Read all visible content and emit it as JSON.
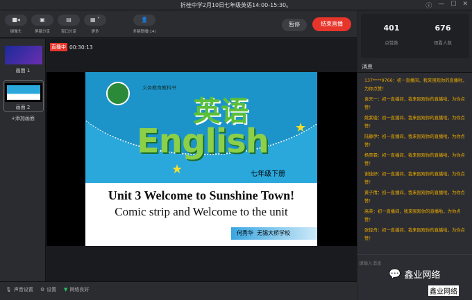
{
  "window": {
    "title": "折桂中学2月10日七年级英语14:00-15:30。"
  },
  "toolbar": {
    "items": [
      {
        "label": "摄像头",
        "icon": "camera-icon"
      },
      {
        "label": "屏幕分享",
        "icon": "screen-share-icon"
      },
      {
        "label": "窗口分享",
        "icon": "window-share-icon"
      },
      {
        "label": "更多",
        "icon": "grid-icon"
      },
      {
        "label": "多路联播(14)",
        "icon": "user-icon"
      }
    ],
    "pause": "暂停",
    "end": "结束直播"
  },
  "left": {
    "scenes": [
      "画面 1",
      "画面 2"
    ],
    "add": "+添加画面"
  },
  "main": {
    "live_badge": "直播中",
    "timer": "00:30:13"
  },
  "slide": {
    "publisher": "义务教育教科书",
    "title_cn": "英语",
    "title_en": "English",
    "grade": "七年级下册",
    "unit": "Unit 3 Welcome to Sunshine Town!",
    "subtitle": "Comic strip and Welcome to the unit",
    "teacher": "何秀华",
    "school": "无锡大桥学校"
  },
  "stats": {
    "likes": "401",
    "likes_label": "点赞数",
    "viewers": "676",
    "viewers_label": "观看人数"
  },
  "messages": {
    "header": "消息",
    "items": [
      "137****9766：初一直播间，我来围观你的直播啦，为你点赞！",
      "袁天一：初一直播间，我来围观你的直播啦，为你点赞！",
      "姚紫璇：初一直播间，我来围观你的直播啦，为你点赞！",
      "陆静伊：初一直播间，我来围观你的直播啦，为你点赞！",
      "杨昊霖：初一直播间，我来围观你的直播啦，为你点赞！",
      "谢佳妤：初一直播间，我来围观你的直播啦，为你点赞！",
      "黄子倩：初一直播间，我来围观你的直播啦，为你点赞！",
      "高荣：初一直播间，我来围观你的直播啦，为你点赞！",
      "张径舟：初一直播间，我来围观你的直播啦，为你点赞！"
    ],
    "placeholder": "请输入消息"
  },
  "bottom": {
    "audio": "声音设置",
    "settings": "设置",
    "network": "网络良好"
  },
  "watermark": "鑫业网络",
  "colors": {
    "accent": "#e8352b",
    "message": "#e6a800"
  }
}
